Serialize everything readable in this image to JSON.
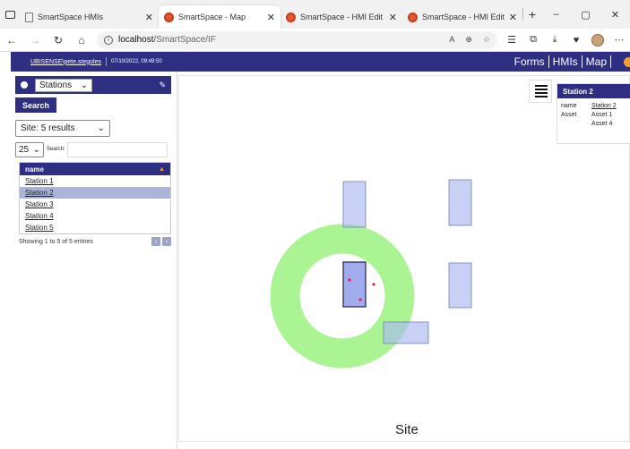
{
  "browser": {
    "tabs": [
      {
        "label": "SmartSpace HMIs",
        "active": false,
        "icon": "page-icon"
      },
      {
        "label": "SmartSpace - Map",
        "active": true,
        "icon": "smartspace-icon"
      },
      {
        "label": "SmartSpace - HMI Edit",
        "active": false,
        "icon": "smartspace-icon"
      },
      {
        "label": "SmartSpace - HMI Edit",
        "active": false,
        "icon": "smartspace-icon"
      }
    ],
    "url_host": "localhost",
    "url_path": "/SmartSpace/IF",
    "window_controls": [
      "–",
      "▢",
      "✕"
    ]
  },
  "header": {
    "user": "UBISENSE\\pete.stegoles",
    "timestamp": "07/10/2022, 09:49:50",
    "nav": [
      "Forms",
      "HMIs",
      "Map"
    ],
    "color": "#2e2e82"
  },
  "panel": {
    "type_select": "Stations",
    "search_button": "Search",
    "site_select": "Site: 5 results",
    "page_length": "25",
    "search_label": "Search:",
    "column_header": "name",
    "rows": [
      "Station 1",
      "Station 2",
      "Station 3",
      "Station 4",
      "Station 5"
    ],
    "selected_index": 1,
    "entries_info": "Showing 1 to 5 of 5 entries"
  },
  "map": {
    "site_label": "Site",
    "ring_color": "#8ef070",
    "box_color": "#aab8f0"
  },
  "popup": {
    "title": "Station 2",
    "name_key": "name",
    "name_value": "Station 2",
    "asset_key": "Asset",
    "assets": [
      "Asset 1",
      "Asset 4"
    ]
  }
}
